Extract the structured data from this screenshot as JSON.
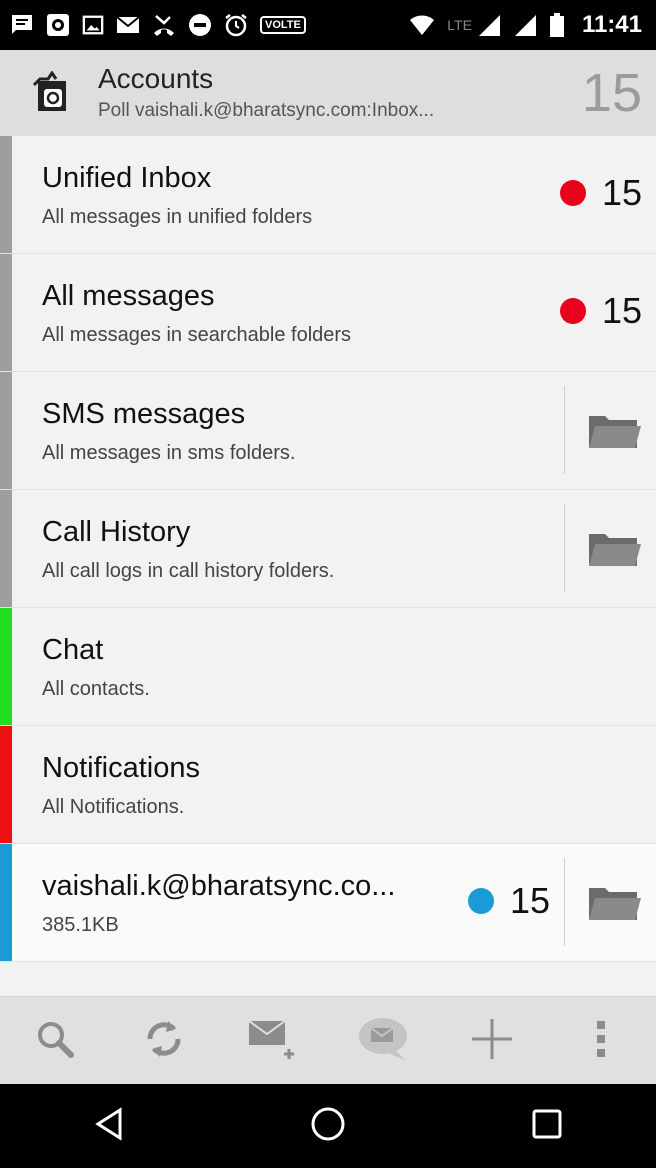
{
  "status_bar": {
    "time": "11:41",
    "volte_label": "VOLTE",
    "lte_label": "LTE",
    "icons": [
      "message-icon",
      "camera-icon",
      "image-icon",
      "mail-icon",
      "missed-call-icon",
      "do-not-disturb-icon",
      "alarm-icon",
      "volte-icon",
      "wifi-icon",
      "signal-icon",
      "signal-icon",
      "battery-icon"
    ]
  },
  "header": {
    "title": "Accounts",
    "subtitle": "Poll vaishali.k@bharatsync.com:Inbox...",
    "count": "15",
    "icon": "app-icon"
  },
  "rows": [
    {
      "title": "Unified Inbox",
      "subtitle": "All messages in unified folders",
      "count": "15",
      "dot_color": "#e8001c",
      "bar_color": "#9e9e9e"
    },
    {
      "title": "All messages",
      "subtitle": "All messages in searchable folders",
      "count": "15",
      "dot_color": "#e8001c",
      "bar_color": "#9e9e9e"
    },
    {
      "title": "SMS messages",
      "subtitle": "All messages in sms folders.",
      "icon": "folder-icon",
      "bar_color": "#9e9e9e"
    },
    {
      "title": "Call History",
      "subtitle": "All call logs in call history folders.",
      "icon": "folder-icon",
      "bar_color": "#9e9e9e"
    },
    {
      "title": "Chat",
      "subtitle": "All contacts.",
      "bar_color": "#22dd22"
    },
    {
      "title": "Notifications",
      "subtitle": "All Notifications.",
      "bar_color": "#ee1111"
    },
    {
      "title": "vaishali.k@bharatsync.co...",
      "subtitle": "385.1KB",
      "count": "15",
      "dot_color": "#1a9ad6",
      "icon": "folder-icon",
      "bar_color": "#1a9ad6"
    }
  ],
  "bottom_bar": {
    "icons": [
      "search-icon",
      "refresh-icon",
      "compose-icon",
      "chat-icon",
      "add-icon",
      "overflow-menu-icon"
    ]
  },
  "nav_bar": {
    "icons": [
      "back-icon",
      "home-icon",
      "recents-icon"
    ]
  }
}
